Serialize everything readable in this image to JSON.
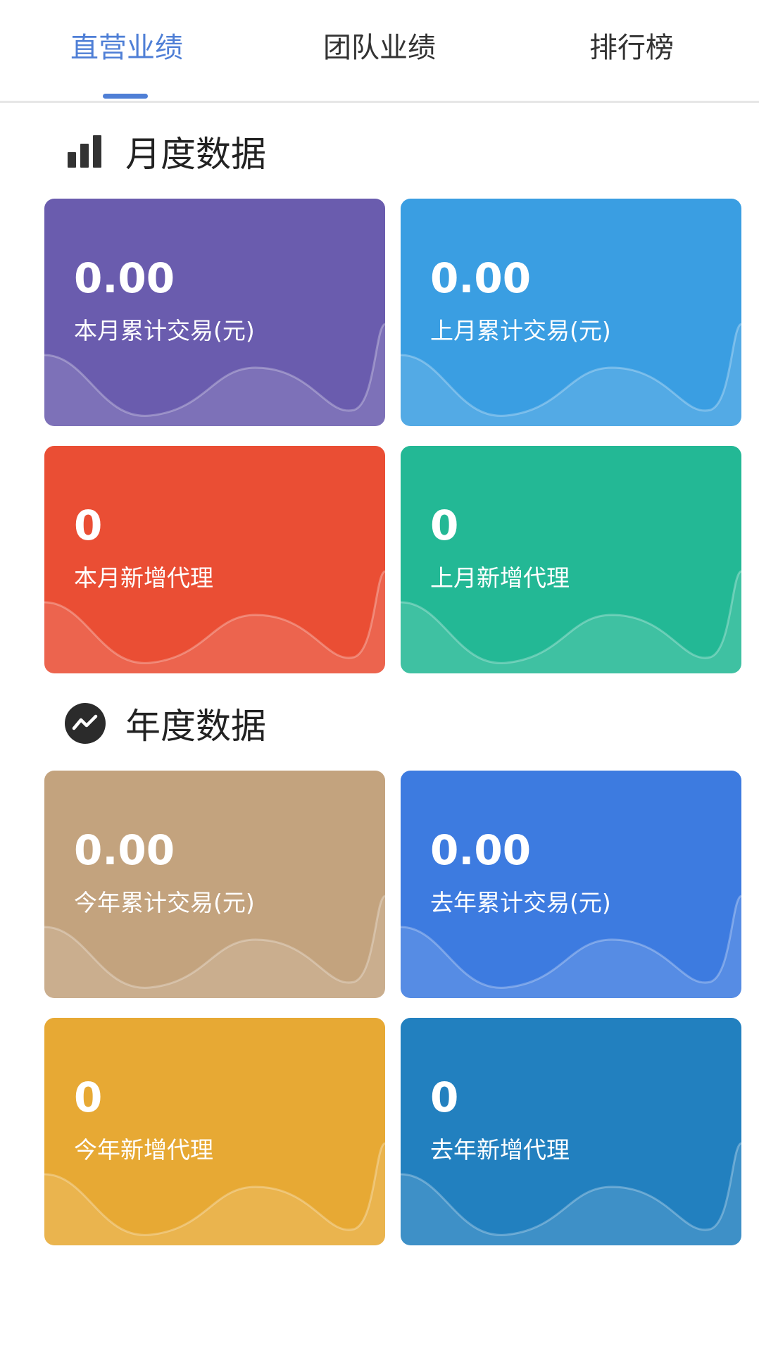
{
  "tabs": [
    {
      "label": "直营业绩",
      "active": true
    },
    {
      "label": "团队业绩",
      "active": false
    },
    {
      "label": "排行榜",
      "active": false
    }
  ],
  "monthly": {
    "title": "月度数据",
    "icon": "bar-chart-icon",
    "cards": [
      {
        "value": "0.00",
        "label": "本月累计交易(元)",
        "color": "#6a5cae"
      },
      {
        "value": "0.00",
        "label": "上月累计交易(元)",
        "color": "#3a9ee2"
      },
      {
        "value": "0",
        "label": "本月新增代理",
        "color": "#ea4e34"
      },
      {
        "value": "0",
        "label": "上月新增代理",
        "color": "#23b895"
      }
    ]
  },
  "yearly": {
    "title": "年度数据",
    "icon": "trend-line-icon",
    "cards": [
      {
        "value": "0.00",
        "label": "今年累计交易(元)",
        "color": "#c3a37e"
      },
      {
        "value": "0.00",
        "label": "去年累计交易(元)",
        "color": "#3d7be0"
      },
      {
        "value": "0",
        "label": "今年新增代理",
        "color": "#e7a934"
      },
      {
        "value": "0",
        "label": "去年新增代理",
        "color": "#2280bf"
      }
    ]
  }
}
